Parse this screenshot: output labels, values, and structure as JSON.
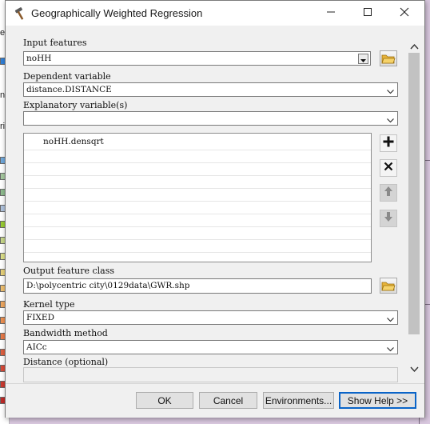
{
  "window": {
    "title": "Geographically Weighted Regression",
    "icon": "hammer-icon"
  },
  "window_controls": [
    "minimize-icon",
    "maximize-icon",
    "close-icon"
  ],
  "form": {
    "input_features": {
      "label": "Input features",
      "value": "noHH"
    },
    "dependent_variable": {
      "label": "Dependent variable",
      "value": "distance.DISTANCE"
    },
    "explanatory_variables": {
      "label": "Explanatory variable(s)",
      "value": "",
      "items": [
        "noHH.densqrt"
      ]
    },
    "output_feature_class": {
      "label": "Output feature class",
      "value": "D:\\polycentric city\\0129data\\GWR.shp"
    },
    "kernel_type": {
      "label": "Kernel type",
      "value": "FIXED"
    },
    "bandwidth_method": {
      "label": "Bandwidth method",
      "value": "AICc"
    },
    "distance": {
      "label": "Distance (optional)",
      "value": ""
    }
  },
  "list_buttons": [
    "add-icon",
    "remove-icon",
    "move-up-icon",
    "move-down-icon"
  ],
  "buttons": {
    "ok": "OK",
    "cancel": "Cancel",
    "environments": "Environments...",
    "show_help": "Show Help >>"
  },
  "background": {
    "letters": [
      "e",
      "o",
      "na",
      "ri"
    ]
  },
  "colors": {
    "accent": "#0a64c8",
    "map_background": "#d9c8df",
    "folder_yellow": "#e8b43a"
  }
}
